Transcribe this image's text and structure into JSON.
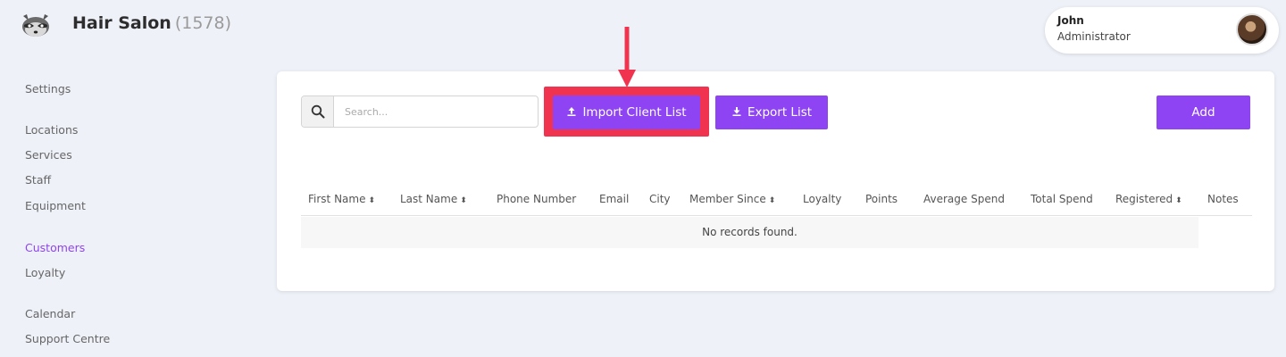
{
  "header": {
    "title": "Hair Salon",
    "count": "(1578)"
  },
  "user": {
    "name": "John",
    "role": "Administrator"
  },
  "sidebar": {
    "items": [
      {
        "label": "Settings",
        "active": false
      },
      {
        "label": "Locations",
        "active": false
      },
      {
        "label": "Services",
        "active": false
      },
      {
        "label": "Staff",
        "active": false
      },
      {
        "label": "Equipment",
        "active": false
      },
      {
        "label": "Customers",
        "active": true
      },
      {
        "label": "Loyalty",
        "active": false
      },
      {
        "label": "Calendar",
        "active": false
      },
      {
        "label": "Support Centre",
        "active": false
      }
    ]
  },
  "toolbar": {
    "search_placeholder": "Search...",
    "import_label": "Import Client List",
    "export_label": "Export List",
    "add_label": "Add"
  },
  "table": {
    "columns": [
      {
        "label": "First Name",
        "sortable": true
      },
      {
        "label": "Last Name",
        "sortable": true
      },
      {
        "label": "Phone Number",
        "sortable": false
      },
      {
        "label": "Email",
        "sortable": false
      },
      {
        "label": "City",
        "sortable": false
      },
      {
        "label": "Member Since",
        "sortable": true
      },
      {
        "label": "Loyalty",
        "sortable": false
      },
      {
        "label": "Points",
        "sortable": false
      },
      {
        "label": "Average Spend",
        "sortable": false
      },
      {
        "label": "Total Spend",
        "sortable": false
      },
      {
        "label": "Registered",
        "sortable": true
      },
      {
        "label": "Notes",
        "sortable": false
      }
    ],
    "empty_message": "No records found."
  },
  "icons": {
    "search": "search-icon",
    "upload": "upload-icon",
    "download": "download-icon",
    "sort": "sort-icon",
    "annotation": "red-arrow-annotation"
  },
  "colors": {
    "accent": "#8e44f2",
    "highlight": "#f0344f",
    "background": "#eef1f8"
  }
}
